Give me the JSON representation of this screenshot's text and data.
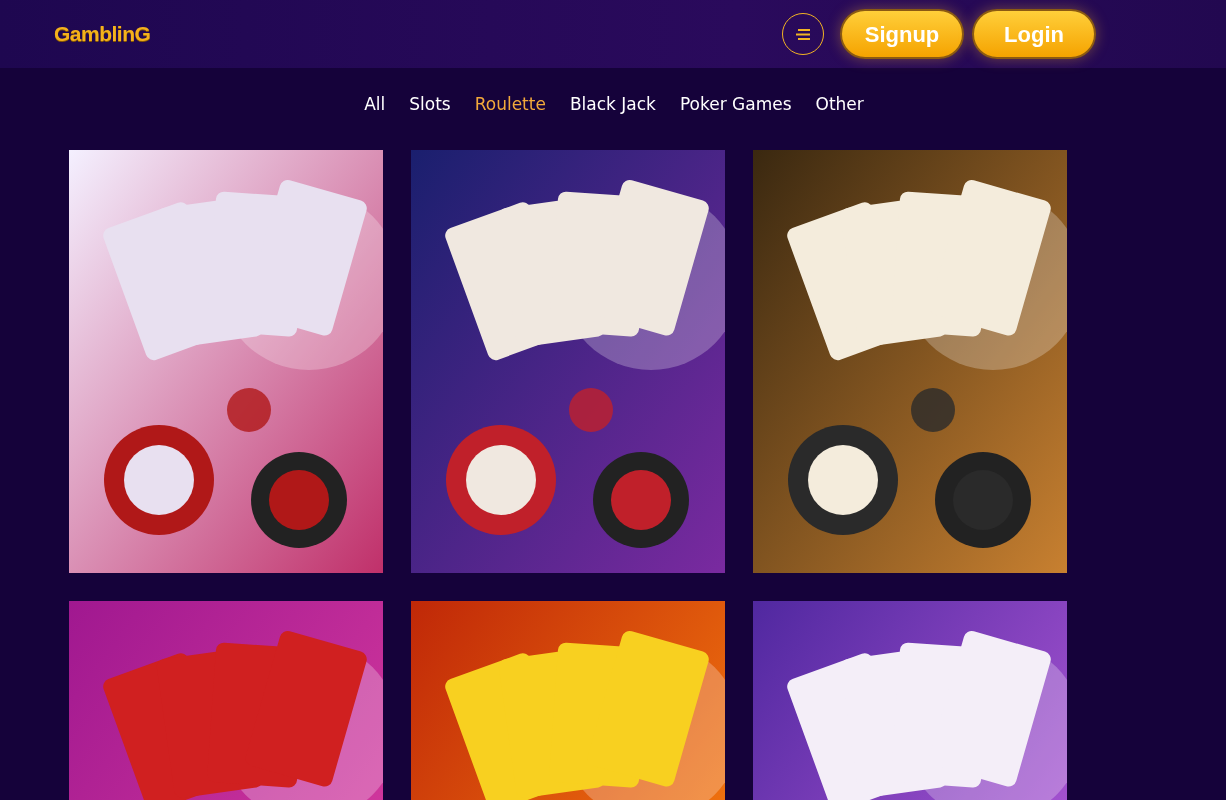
{
  "header": {
    "logo": "GamblinG",
    "buttons": [
      "Signup",
      "Login"
    ]
  },
  "filters": [
    {
      "label": "All",
      "selected": false
    },
    {
      "label": "Slots",
      "selected": false
    },
    {
      "label": "Roulette",
      "selected": true
    },
    {
      "label": "Black Jack",
      "selected": false
    },
    {
      "label": "Poker Games",
      "selected": false
    },
    {
      "label": "Other",
      "selected": false
    }
  ]
}
